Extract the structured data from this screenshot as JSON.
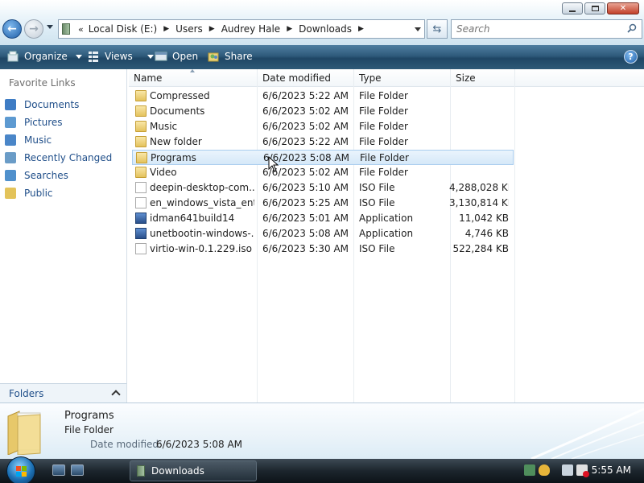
{
  "window": {
    "address": {
      "overflow_marker": "«",
      "crumbs": [
        "Local Disk (E:)",
        "Users",
        "Audrey Hale",
        "Downloads"
      ]
    },
    "search_placeholder": "Search"
  },
  "toolbar": {
    "organize": "Organize",
    "views": "Views",
    "open": "Open",
    "share": "Share",
    "help": "?"
  },
  "navpane": {
    "heading": "Favorite Links",
    "items": [
      {
        "label": "Documents",
        "icon": "documents-icon",
        "color": "#3e7cc4"
      },
      {
        "label": "Pictures",
        "icon": "pictures-icon",
        "color": "#5d9ad1"
      },
      {
        "label": "Music",
        "icon": "music-icon",
        "color": "#4a86c8"
      },
      {
        "label": "Recently Changed",
        "icon": "recently-changed-icon",
        "color": "#6a9cc7"
      },
      {
        "label": "Searches",
        "icon": "searches-icon",
        "color": "#4f90cc"
      },
      {
        "label": "Public",
        "icon": "public-folder-icon",
        "color": "#e3c35a"
      }
    ],
    "folders_label": "Folders"
  },
  "columns": {
    "name": "Name",
    "date": "Date modified",
    "type": "Type",
    "size": "Size"
  },
  "files": [
    {
      "name": "Compressed",
      "date": "6/6/2023 5:22 AM",
      "type": "File Folder",
      "size": "",
      "kind": "folder"
    },
    {
      "name": "Documents",
      "date": "6/6/2023 5:02 AM",
      "type": "File Folder",
      "size": "",
      "kind": "folder"
    },
    {
      "name": "Music",
      "date": "6/6/2023 5:02 AM",
      "type": "File Folder",
      "size": "",
      "kind": "folder"
    },
    {
      "name": "New folder",
      "date": "6/6/2023 5:22 AM",
      "type": "File Folder",
      "size": "",
      "kind": "folder"
    },
    {
      "name": "Programs",
      "date": "6/6/2023 5:08 AM",
      "type": "File Folder",
      "size": "",
      "kind": "folder",
      "selected": true
    },
    {
      "name": "Video",
      "date": "6/6/2023 5:02 AM",
      "type": "File Folder",
      "size": "",
      "kind": "folder"
    },
    {
      "name": "deepin-desktop-com...",
      "date": "6/6/2023 5:10 AM",
      "type": "ISO File",
      "size": "4,288,028 KB",
      "kind": "file"
    },
    {
      "name": "en_windows_vista_ent...",
      "date": "6/6/2023 5:25 AM",
      "type": "ISO File",
      "size": "3,130,814 KB",
      "kind": "file"
    },
    {
      "name": "idman641build14",
      "date": "6/6/2023 5:01 AM",
      "type": "Application",
      "size": "11,042 KB",
      "kind": "app"
    },
    {
      "name": "unetbootin-windows-...",
      "date": "6/6/2023 5:08 AM",
      "type": "Application",
      "size": "4,746 KB",
      "kind": "app"
    },
    {
      "name": "virtio-win-0.1.229.iso",
      "date": "6/6/2023 5:30 AM",
      "type": "ISO File",
      "size": "522,284 KB",
      "kind": "file"
    }
  ],
  "details": {
    "name": "Programs",
    "type": "File Folder",
    "modified_label": "Date modified:",
    "modified_value": "6/6/2023 5:08 AM"
  },
  "taskbar": {
    "task_label": "Downloads",
    "clock": "5:55 AM"
  }
}
